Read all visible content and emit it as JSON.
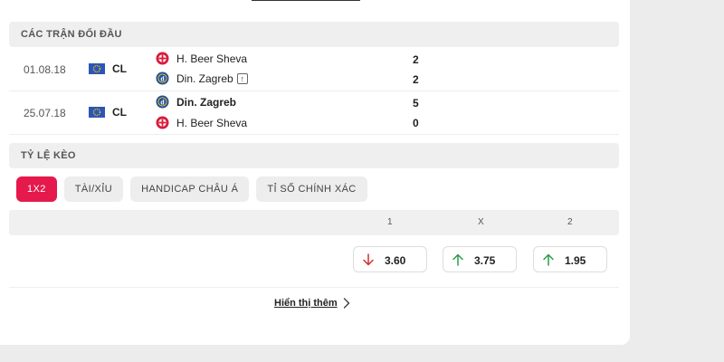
{
  "h2h": {
    "title": "CÁC TRẬN ĐỐI ĐẦU",
    "matches": [
      {
        "date": "01.08.18",
        "competition": "CL",
        "home": {
          "name": "H. Beer Sheva",
          "score": "2",
          "bold": false
        },
        "away": {
          "name": "Din. Zagreb",
          "score": "2",
          "bold": false
        }
      },
      {
        "date": "25.07.18",
        "competition": "CL",
        "home": {
          "name": "Din. Zagreb",
          "score": "5",
          "bold": true
        },
        "away": {
          "name": "H. Beer Sheva",
          "score": "0",
          "bold": false
        }
      }
    ]
  },
  "odds": {
    "title": "TỶ LỆ KÈO",
    "tabs": [
      "1X2",
      "TÀI/XỈU",
      "HANDICAP CHÂU Á",
      "TỈ SỐ CHÍNH XÁC"
    ],
    "active_tab": "1X2",
    "columns": [
      "1",
      "X",
      "2"
    ],
    "values": [
      {
        "value": "3.60",
        "trend": "down"
      },
      {
        "value": "3.75",
        "trend": "up"
      },
      {
        "value": "1.95",
        "trend": "up"
      }
    ]
  },
  "show_more_label": "Hiển thị thêm",
  "colors": {
    "accent": "#e5194b",
    "trend_up": "#2a9d4a",
    "trend_down": "#d32f2f",
    "beer_sheva": "#d81b3c",
    "zagreb": "#1f4fa6"
  }
}
